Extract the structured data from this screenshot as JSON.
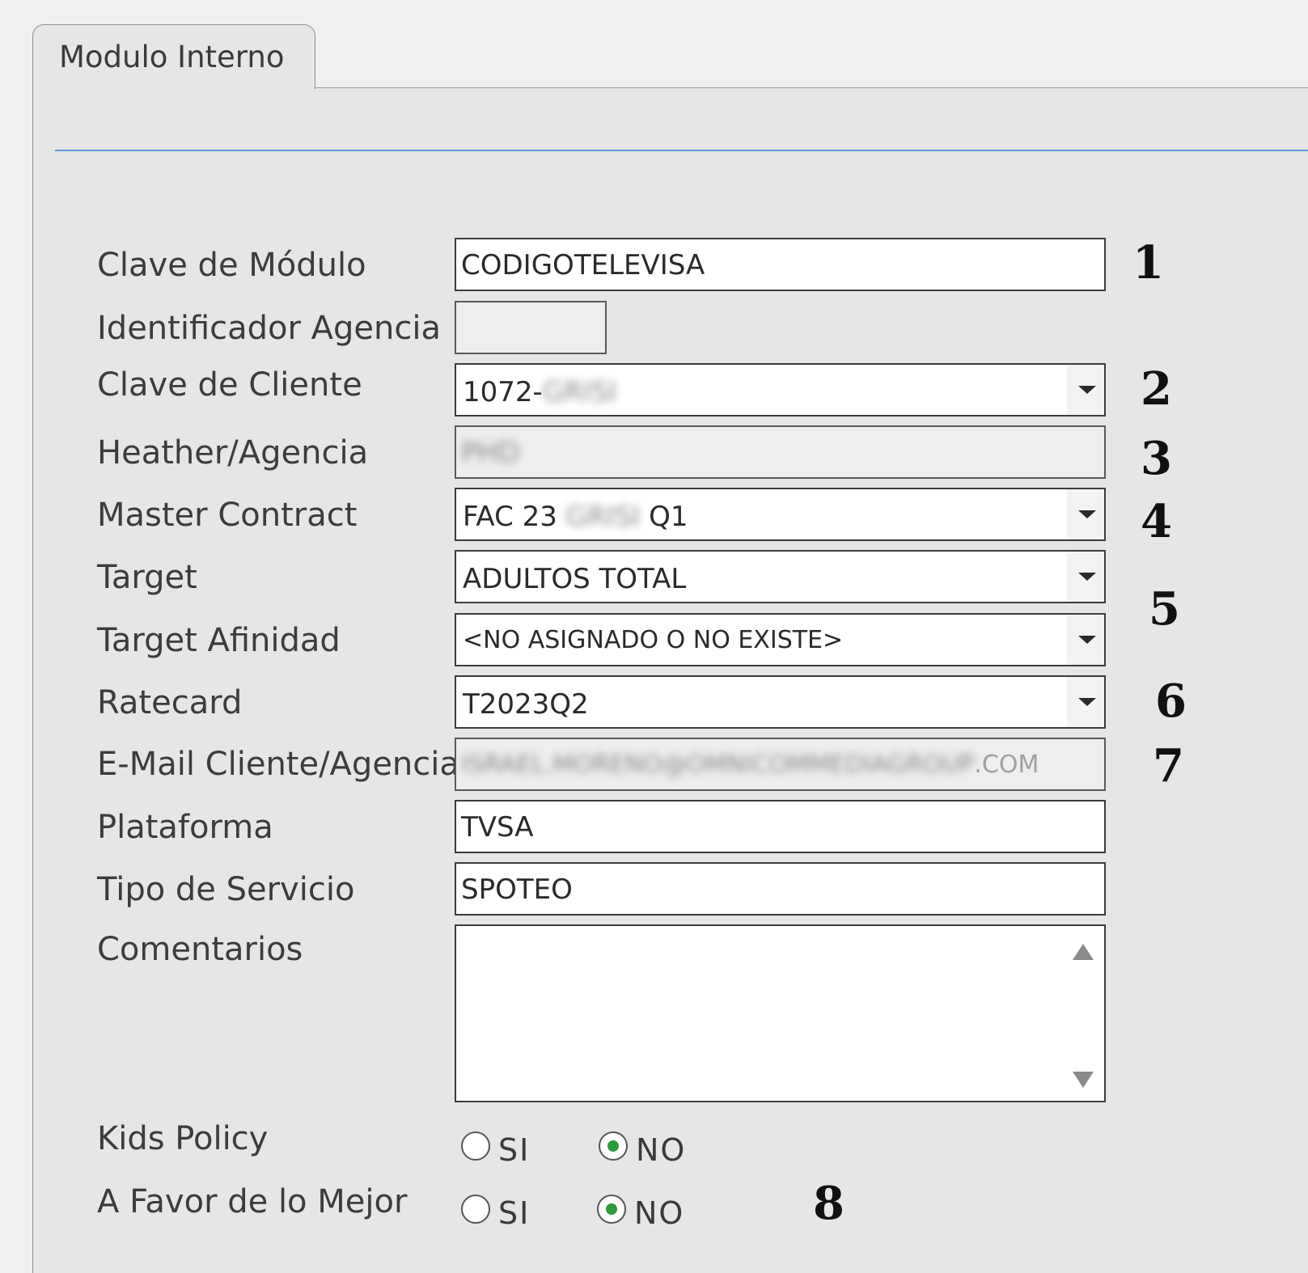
{
  "tab": {
    "label": "Modulo Interno"
  },
  "form": {
    "clave_modulo": {
      "label": "Clave de Módulo",
      "value": "CODIGOTELEVISA"
    },
    "identificador_agencia": {
      "label": "Identificador Agencia",
      "value": ""
    },
    "clave_cliente": {
      "label": "Clave de Cliente",
      "value_prefix": "1072-",
      "value_redacted": "GRISI"
    },
    "heather_agencia": {
      "label": "Heather/Agencia",
      "value_redacted": "PHD"
    },
    "master_contract": {
      "label": "Master Contract",
      "value_prefix": "FAC 23 ",
      "value_redacted": "GRISI",
      "value_suffix": " Q1"
    },
    "target": {
      "label": "Target",
      "value": "ADULTOS TOTAL"
    },
    "target_afinidad": {
      "label": "Target Afinidad",
      "value": "<NO ASIGNADO O NO EXISTE>"
    },
    "ratecard": {
      "label": "Ratecard",
      "value": "T2023Q2"
    },
    "email": {
      "label": "E-Mail Cliente/Agencia",
      "value_redacted": "ISRAEL.MORENO@OMNICOMMEDIAGROUP",
      "value_suffix": ".COM"
    },
    "plataforma": {
      "label": "Plataforma",
      "value": "TVSA"
    },
    "tipo_servicio": {
      "label": "Tipo de Servicio",
      "value": "SPOTEO"
    },
    "comentarios": {
      "label": "Comentarios",
      "value": ""
    },
    "kids_policy": {
      "label": "Kids Policy",
      "option_si": "SI",
      "option_no": "NO",
      "selected": "NO"
    },
    "a_favor": {
      "label": "A Favor de lo Mejor",
      "option_si": "SI",
      "option_no": "NO",
      "selected": "NO"
    }
  },
  "annotations": [
    "1",
    "2",
    "3",
    "4",
    "5",
    "6",
    "7",
    "8"
  ]
}
